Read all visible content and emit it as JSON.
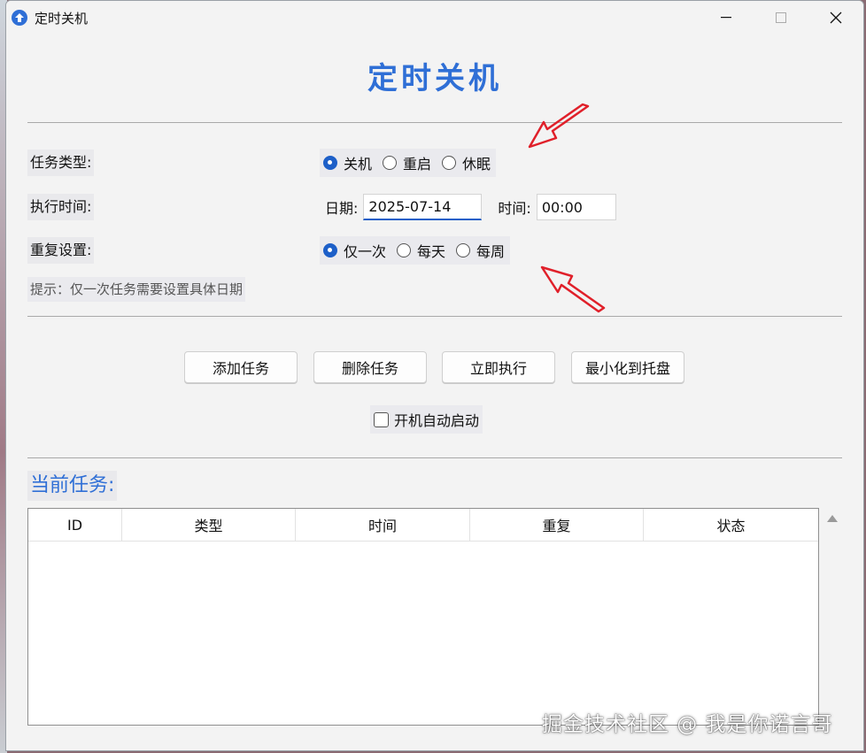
{
  "window": {
    "title": "定时关机"
  },
  "heading": "定时关机",
  "task_type": {
    "label": "任务类型:",
    "options": [
      {
        "label": "关机",
        "checked": true
      },
      {
        "label": "重启",
        "checked": false
      },
      {
        "label": "休眠",
        "checked": false
      }
    ]
  },
  "exec_time": {
    "label": "执行时间:",
    "date_label": "日期:",
    "date_value": "2025-07-14",
    "time_label": "时间:",
    "time_value": "00:00"
  },
  "repeat": {
    "label": "重复设置:",
    "options": [
      {
        "label": "仅一次",
        "checked": true
      },
      {
        "label": "每天",
        "checked": false
      },
      {
        "label": "每周",
        "checked": false
      }
    ]
  },
  "hint": "提示：仅一次任务需要设置具体日期",
  "buttons": {
    "add": "添加任务",
    "delete": "删除任务",
    "run_now": "立即执行",
    "minimize_tray": "最小化到托盘"
  },
  "autostart": {
    "label": "开机自动启动",
    "checked": false
  },
  "tasks": {
    "title": "当前任务:",
    "columns": [
      "ID",
      "类型",
      "时间",
      "重复",
      "状态"
    ],
    "rows": []
  },
  "watermark": "掘金技术社区 @ 我是你诺言哥",
  "colors": {
    "accent": "#2f6fd6",
    "annotation_arrow": "#e0202a"
  }
}
